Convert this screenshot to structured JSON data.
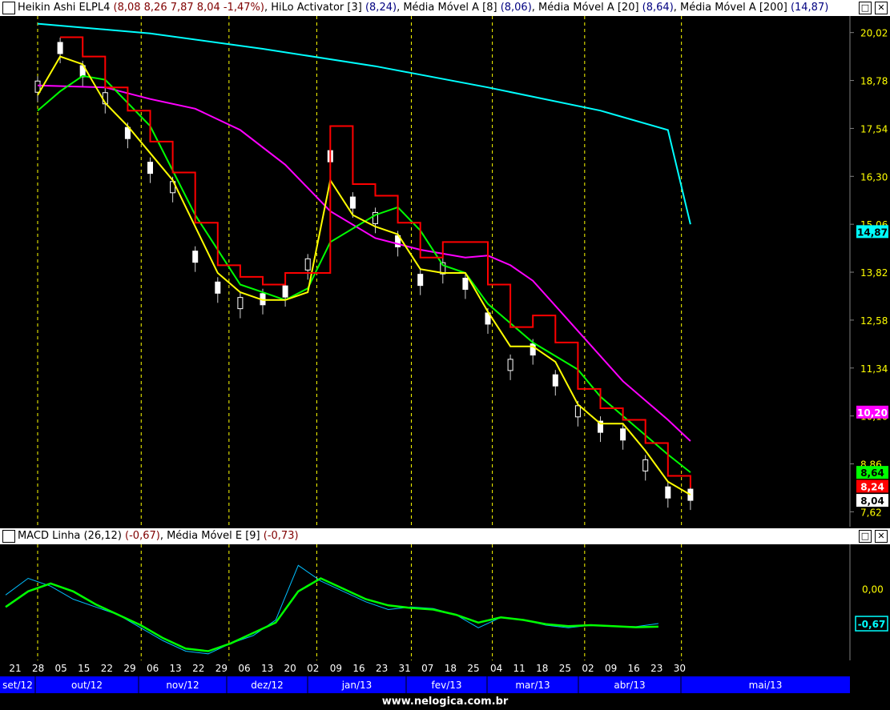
{
  "main_panel": {
    "title_segments": [
      {
        "text": "Heikin Ashi ELPL4 ",
        "color": "#000000"
      },
      {
        "text": "(8,08  8,26  7,87  8,04  -1,47%)",
        "color": "#800000"
      },
      {
        "text": ", HiLo Activator [3] ",
        "color": "#000000"
      },
      {
        "text": "(8,24)",
        "color": "#000080"
      },
      {
        "text": ", Média Móvel A [8] ",
        "color": "#000000"
      },
      {
        "text": "(8,06)",
        "color": "#000080"
      },
      {
        "text": ", Média Móvel A [20] ",
        "color": "#000000"
      },
      {
        "text": "(8,64)",
        "color": "#000080"
      },
      {
        "text": ", Média Móvel A [200] ",
        "color": "#000000"
      },
      {
        "text": "(14,87)",
        "color": "#000080"
      }
    ],
    "controls": [
      "□",
      "✕"
    ]
  },
  "macd_panel": {
    "title_segments": [
      {
        "text": "MACD Linha (26,12) ",
        "color": "#000000"
      },
      {
        "text": "(-0,67)",
        "color": "#800000"
      },
      {
        "text": ", Média Móvel E [9] ",
        "color": "#000000"
      },
      {
        "text": "(-0,73)",
        "color": "#800000"
      }
    ],
    "controls": [
      "□",
      "✕"
    ]
  },
  "footer_text": "www.nelogica.com.br",
  "chart_data": [
    {
      "type": "candlestick",
      "title": "Heikin Ashi ELPL4",
      "ylim": [
        7.4,
        20.2
      ],
      "y_ticks": [
        "20,02",
        "18,78",
        "17,54",
        "16,30",
        "15,06",
        "13,82",
        "12,58",
        "11,34",
        "10,10",
        "8,86",
        "7,62"
      ],
      "x_day_labels": [
        "21",
        "28",
        "05",
        "15",
        "22",
        "29",
        "06",
        "13",
        "22",
        "29",
        "06",
        "13",
        "20",
        "02",
        "09",
        "16",
        "23",
        "31",
        "07",
        "18",
        "25",
        "04",
        "11",
        "18",
        "25",
        "02",
        "09",
        "16",
        "23",
        "30"
      ],
      "x_month_labels": [
        "set/12",
        "out/12",
        "nov/12",
        "dez/12",
        "jan/13",
        "fev/13",
        "mar/13",
        "abr/13",
        "mai/13"
      ],
      "last_values": [
        {
          "label": "14,87",
          "series": "Média Móvel A [200]",
          "color": "#00ffff"
        },
        {
          "label": "10,20",
          "series": "Média Móvel A [200] (magenta)",
          "color": "#ff00ff"
        },
        {
          "label": "8,64",
          "series": "Média Móvel A [20]",
          "color": "#00ff00"
        },
        {
          "label": "8,24",
          "series": "HiLo Activator [3]",
          "color": "#ff0000"
        },
        {
          "label": "8,04",
          "series": "Heikin Ashi ELPL4",
          "color": "#ffffff"
        }
      ],
      "series": [
        {
          "name": "Média Móvel A [200]",
          "color": "#00ffff",
          "points": [
            [
              0,
              20.25
            ],
            [
              5,
              20.0
            ],
            [
              10,
              19.6
            ],
            [
              15,
              19.15
            ],
            [
              20,
              18.6
            ],
            [
              25,
              18.0
            ],
            [
              28,
              17.5
            ],
            [
              29,
              15.06
            ]
          ]
        },
        {
          "name": "Média Móvel A (magenta)",
          "color": "#ff00ff",
          "points": [
            [
              0,
              18.65
            ],
            [
              3,
              18.6
            ],
            [
              5,
              18.3
            ],
            [
              7,
              18.05
            ],
            [
              9,
              17.5
            ],
            [
              11,
              16.6
            ],
            [
              13,
              15.4
            ],
            [
              15,
              14.7
            ],
            [
              17,
              14.4
            ],
            [
              19,
              14.2
            ],
            [
              20,
              14.25
            ],
            [
              21,
              14.0
            ],
            [
              22,
              13.6
            ],
            [
              24,
              12.3
            ],
            [
              26,
              11.0
            ],
            [
              28,
              10.0
            ],
            [
              29,
              9.45
            ]
          ]
        },
        {
          "name": "Média Móvel A [20]",
          "color": "#00ff00",
          "points": [
            [
              0,
              18.0
            ],
            [
              1,
              18.5
            ],
            [
              2,
              18.9
            ],
            [
              3,
              18.8
            ],
            [
              5,
              17.6
            ],
            [
              7,
              15.3
            ],
            [
              9,
              13.5
            ],
            [
              10,
              13.3
            ],
            [
              11,
              13.1
            ],
            [
              12,
              13.4
            ],
            [
              13,
              14.6
            ],
            [
              15,
              15.3
            ],
            [
              16,
              15.5
            ],
            [
              17,
              14.9
            ],
            [
              18,
              14.0
            ],
            [
              19,
              13.8
            ],
            [
              20,
              13.0
            ],
            [
              22,
              12.0
            ],
            [
              24,
              11.3
            ],
            [
              25,
              10.6
            ],
            [
              26,
              10.1
            ],
            [
              27,
              9.6
            ],
            [
              28,
              9.1
            ],
            [
              29,
              8.64
            ]
          ]
        },
        {
          "name": "Média Móvel A [8]",
          "color": "#ffff00",
          "points": [
            [
              0,
              18.4
            ],
            [
              1,
              19.4
            ],
            [
              2,
              19.2
            ],
            [
              3,
              18.2
            ],
            [
              4,
              17.6
            ],
            [
              5,
              16.9
            ],
            [
              6,
              16.2
            ],
            [
              7,
              15.0
            ],
            [
              8,
              13.8
            ],
            [
              9,
              13.3
            ],
            [
              10,
              13.1
            ],
            [
              11,
              13.1
            ],
            [
              12,
              13.3
            ],
            [
              13,
              16.2
            ],
            [
              14,
              15.3
            ],
            [
              15,
              15.0
            ],
            [
              16,
              14.8
            ],
            [
              17,
              13.9
            ],
            [
              18,
              13.8
            ],
            [
              19,
              13.8
            ],
            [
              20,
              12.8
            ],
            [
              21,
              11.9
            ],
            [
              22,
              11.9
            ],
            [
              23,
              11.5
            ],
            [
              24,
              10.4
            ],
            [
              25,
              9.9
            ],
            [
              26,
              9.9
            ],
            [
              27,
              9.2
            ],
            [
              28,
              8.4
            ],
            [
              29,
              8.06
            ]
          ]
        },
        {
          "name": "HiLo Activator [3]",
          "color": "#ff0000",
          "points": [
            [
              1,
              19.9
            ],
            [
              2,
              19.4
            ],
            [
              3,
              18.6
            ],
            [
              4,
              18.0
            ],
            [
              5,
              17.2
            ],
            [
              6,
              16.4
            ],
            [
              7,
              15.1
            ],
            [
              8,
              14.0
            ],
            [
              9,
              13.7
            ],
            [
              10,
              13.5
            ],
            [
              11,
              13.8
            ],
            [
              13,
              17.6
            ],
            [
              14,
              16.1
            ],
            [
              15,
              15.8
            ],
            [
              16,
              15.1
            ],
            [
              17,
              14.2
            ],
            [
              18,
              14.6
            ],
            [
              20,
              13.5
            ],
            [
              21,
              12.4
            ],
            [
              22,
              12.7
            ],
            [
              23,
              12.0
            ],
            [
              24,
              10.8
            ],
            [
              25,
              10.3
            ],
            [
              26,
              10.0
            ],
            [
              27,
              9.4
            ],
            [
              28,
              8.55
            ],
            [
              29,
              8.24
            ]
          ]
        },
        {
          "name": "Heikin Ashi ELPL4",
          "color": "#ffffff",
          "points": [
            [
              0,
              18.6
            ],
            [
              1,
              19.6
            ],
            [
              2,
              19.0
            ],
            [
              3,
              18.3
            ],
            [
              4,
              17.4
            ],
            [
              5,
              16.5
            ],
            [
              6,
              16.0
            ],
            [
              7,
              14.2
            ],
            [
              8,
              13.4
            ],
            [
              9,
              13.0
            ],
            [
              10,
              13.1
            ],
            [
              11,
              13.3
            ],
            [
              12,
              14.0
            ],
            [
              13,
              16.8
            ],
            [
              14,
              15.6
            ],
            [
              15,
              15.2
            ],
            [
              16,
              14.6
            ],
            [
              17,
              13.6
            ],
            [
              18,
              13.9
            ],
            [
              19,
              13.5
            ],
            [
              20,
              12.6
            ],
            [
              21,
              11.4
            ],
            [
              22,
              11.8
            ],
            [
              23,
              11.0
            ],
            [
              24,
              10.2
            ],
            [
              25,
              9.8
            ],
            [
              26,
              9.6
            ],
            [
              27,
              8.8
            ],
            [
              28,
              8.1
            ],
            [
              29,
              8.04
            ]
          ]
        }
      ]
    },
    {
      "type": "line",
      "title": "MACD Linha (26,12)",
      "ylim": [
        -1.3,
        0.7
      ],
      "y_ticks": [
        "0,00"
      ],
      "last_values": [
        {
          "label": "-0,67",
          "series": "MACD Linha (26,12)",
          "color": "#00ffff"
        }
      ],
      "series": [
        {
          "name": "MACD Linha (26,12)",
          "color": "#00bfff",
          "points": [
            [
              0,
              -0.12
            ],
            [
              1,
              0.2
            ],
            [
              2,
              0.05
            ],
            [
              3,
              -0.2
            ],
            [
              4,
              -0.35
            ],
            [
              5,
              -0.5
            ],
            [
              6,
              -0.75
            ],
            [
              7,
              -1.0
            ],
            [
              8,
              -1.2
            ],
            [
              9,
              -1.25
            ],
            [
              10,
              -1.05
            ],
            [
              11,
              -0.9
            ],
            [
              12,
              -0.6
            ],
            [
              13,
              0.45
            ],
            [
              14,
              0.15
            ],
            [
              15,
              -0.05
            ],
            [
              16,
              -0.25
            ],
            [
              17,
              -0.4
            ],
            [
              18,
              -0.35
            ],
            [
              19,
              -0.38
            ],
            [
              20,
              -0.5
            ],
            [
              21,
              -0.75
            ],
            [
              22,
              -0.55
            ],
            [
              23,
              -0.6
            ],
            [
              24,
              -0.7
            ],
            [
              25,
              -0.75
            ],
            [
              26,
              -0.7
            ],
            [
              27,
              -0.72
            ],
            [
              28,
              -0.73
            ],
            [
              29,
              -0.67
            ]
          ]
        },
        {
          "name": "Média Móvel E [9]",
          "color": "#00ff00",
          "points": [
            [
              0,
              -0.35
            ],
            [
              1,
              -0.05
            ],
            [
              2,
              0.1
            ],
            [
              3,
              -0.05
            ],
            [
              4,
              -0.3
            ],
            [
              5,
              -0.5
            ],
            [
              6,
              -0.7
            ],
            [
              7,
              -0.95
            ],
            [
              8,
              -1.15
            ],
            [
              9,
              -1.2
            ],
            [
              10,
              -1.05
            ],
            [
              11,
              -0.85
            ],
            [
              12,
              -0.65
            ],
            [
              13,
              -0.05
            ],
            [
              14,
              0.2
            ],
            [
              15,
              0.0
            ],
            [
              16,
              -0.2
            ],
            [
              17,
              -0.32
            ],
            [
              18,
              -0.37
            ],
            [
              19,
              -0.4
            ],
            [
              20,
              -0.5
            ],
            [
              21,
              -0.65
            ],
            [
              22,
              -0.55
            ],
            [
              23,
              -0.6
            ],
            [
              24,
              -0.68
            ],
            [
              25,
              -0.72
            ],
            [
              26,
              -0.7
            ],
            [
              27,
              -0.72
            ],
            [
              28,
              -0.74
            ],
            [
              29,
              -0.73
            ]
          ]
        }
      ]
    }
  ]
}
